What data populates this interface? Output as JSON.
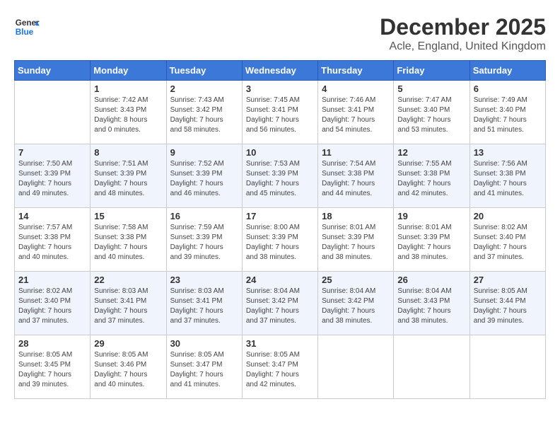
{
  "header": {
    "logo_line1": "General",
    "logo_line2": "Blue",
    "title": "December 2025",
    "subtitle": "Acle, England, United Kingdom"
  },
  "weekdays": [
    "Sunday",
    "Monday",
    "Tuesday",
    "Wednesday",
    "Thursday",
    "Friday",
    "Saturday"
  ],
  "weeks": [
    [
      {
        "day": "",
        "info": ""
      },
      {
        "day": "1",
        "info": "Sunrise: 7:42 AM\nSunset: 3:43 PM\nDaylight: 8 hours\nand 0 minutes."
      },
      {
        "day": "2",
        "info": "Sunrise: 7:43 AM\nSunset: 3:42 PM\nDaylight: 7 hours\nand 58 minutes."
      },
      {
        "day": "3",
        "info": "Sunrise: 7:45 AM\nSunset: 3:41 PM\nDaylight: 7 hours\nand 56 minutes."
      },
      {
        "day": "4",
        "info": "Sunrise: 7:46 AM\nSunset: 3:41 PM\nDaylight: 7 hours\nand 54 minutes."
      },
      {
        "day": "5",
        "info": "Sunrise: 7:47 AM\nSunset: 3:40 PM\nDaylight: 7 hours\nand 53 minutes."
      },
      {
        "day": "6",
        "info": "Sunrise: 7:49 AM\nSunset: 3:40 PM\nDaylight: 7 hours\nand 51 minutes."
      }
    ],
    [
      {
        "day": "7",
        "info": "Sunrise: 7:50 AM\nSunset: 3:39 PM\nDaylight: 7 hours\nand 49 minutes."
      },
      {
        "day": "8",
        "info": "Sunrise: 7:51 AM\nSunset: 3:39 PM\nDaylight: 7 hours\nand 48 minutes."
      },
      {
        "day": "9",
        "info": "Sunrise: 7:52 AM\nSunset: 3:39 PM\nDaylight: 7 hours\nand 46 minutes."
      },
      {
        "day": "10",
        "info": "Sunrise: 7:53 AM\nSunset: 3:39 PM\nDaylight: 7 hours\nand 45 minutes."
      },
      {
        "day": "11",
        "info": "Sunrise: 7:54 AM\nSunset: 3:38 PM\nDaylight: 7 hours\nand 44 minutes."
      },
      {
        "day": "12",
        "info": "Sunrise: 7:55 AM\nSunset: 3:38 PM\nDaylight: 7 hours\nand 42 minutes."
      },
      {
        "day": "13",
        "info": "Sunrise: 7:56 AM\nSunset: 3:38 PM\nDaylight: 7 hours\nand 41 minutes."
      }
    ],
    [
      {
        "day": "14",
        "info": "Sunrise: 7:57 AM\nSunset: 3:38 PM\nDaylight: 7 hours\nand 40 minutes."
      },
      {
        "day": "15",
        "info": "Sunrise: 7:58 AM\nSunset: 3:38 PM\nDaylight: 7 hours\nand 40 minutes."
      },
      {
        "day": "16",
        "info": "Sunrise: 7:59 AM\nSunset: 3:39 PM\nDaylight: 7 hours\nand 39 minutes."
      },
      {
        "day": "17",
        "info": "Sunrise: 8:00 AM\nSunset: 3:39 PM\nDaylight: 7 hours\nand 38 minutes."
      },
      {
        "day": "18",
        "info": "Sunrise: 8:01 AM\nSunset: 3:39 PM\nDaylight: 7 hours\nand 38 minutes."
      },
      {
        "day": "19",
        "info": "Sunrise: 8:01 AM\nSunset: 3:39 PM\nDaylight: 7 hours\nand 38 minutes."
      },
      {
        "day": "20",
        "info": "Sunrise: 8:02 AM\nSunset: 3:40 PM\nDaylight: 7 hours\nand 37 minutes."
      }
    ],
    [
      {
        "day": "21",
        "info": "Sunrise: 8:02 AM\nSunset: 3:40 PM\nDaylight: 7 hours\nand 37 minutes."
      },
      {
        "day": "22",
        "info": "Sunrise: 8:03 AM\nSunset: 3:41 PM\nDaylight: 7 hours\nand 37 minutes."
      },
      {
        "day": "23",
        "info": "Sunrise: 8:03 AM\nSunset: 3:41 PM\nDaylight: 7 hours\nand 37 minutes."
      },
      {
        "day": "24",
        "info": "Sunrise: 8:04 AM\nSunset: 3:42 PM\nDaylight: 7 hours\nand 37 minutes."
      },
      {
        "day": "25",
        "info": "Sunrise: 8:04 AM\nSunset: 3:42 PM\nDaylight: 7 hours\nand 38 minutes."
      },
      {
        "day": "26",
        "info": "Sunrise: 8:04 AM\nSunset: 3:43 PM\nDaylight: 7 hours\nand 38 minutes."
      },
      {
        "day": "27",
        "info": "Sunrise: 8:05 AM\nSunset: 3:44 PM\nDaylight: 7 hours\nand 39 minutes."
      }
    ],
    [
      {
        "day": "28",
        "info": "Sunrise: 8:05 AM\nSunset: 3:45 PM\nDaylight: 7 hours\nand 39 minutes."
      },
      {
        "day": "29",
        "info": "Sunrise: 8:05 AM\nSunset: 3:46 PM\nDaylight: 7 hours\nand 40 minutes."
      },
      {
        "day": "30",
        "info": "Sunrise: 8:05 AM\nSunset: 3:47 PM\nDaylight: 7 hours\nand 41 minutes."
      },
      {
        "day": "31",
        "info": "Sunrise: 8:05 AM\nSunset: 3:47 PM\nDaylight: 7 hours\nand 42 minutes."
      },
      {
        "day": "",
        "info": ""
      },
      {
        "day": "",
        "info": ""
      },
      {
        "day": "",
        "info": ""
      }
    ]
  ]
}
